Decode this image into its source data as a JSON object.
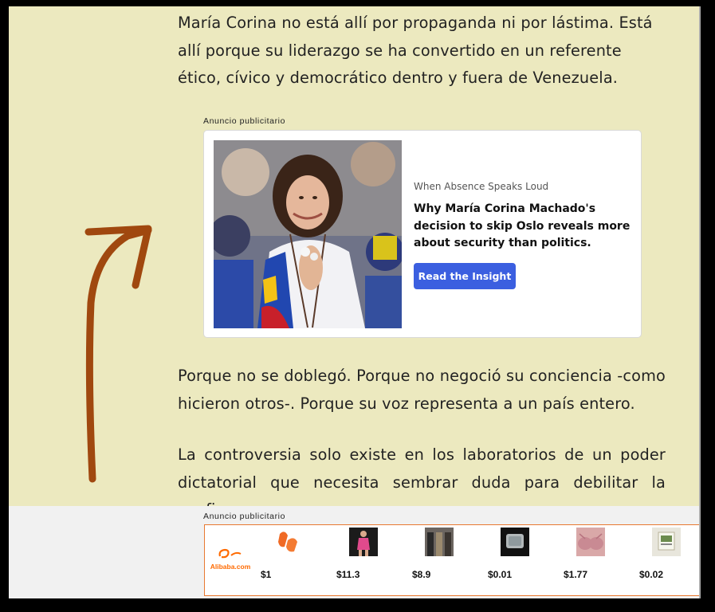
{
  "article": {
    "paragraphs": [
      "María Corina no está allí por propaganda ni por lástima. Está allí porque su liderazgo se ha convertido en un referente ético, cívico y democrático dentro y fuera de Venezuela.",
      "Porque no se doblegó. Porque no negoció su conciencia -como hicieron otros-. Porque su voz representa a un país entero.",
      "La controversia solo existe en los laboratorios de un poder dictatorial que necesita sembrar duda para debilitar la confianza."
    ]
  },
  "ad1": {
    "label": "Anuncio publicitario",
    "kicker": "When Absence Speaks Loud",
    "title": "Why María Corina Machado's decision to skip Oslo reveals more about security than politics.",
    "cta": "Read the Insight"
  },
  "ad2": {
    "label": "Anuncio publicitario",
    "logo_text": "Alibaba.com",
    "products": [
      {
        "price": "$1",
        "icon": "orange-earplugs-icon"
      },
      {
        "price": "$11.3",
        "icon": "pink-outfit-model-icon"
      },
      {
        "price": "$8.9",
        "icon": "trousers-models-icon"
      },
      {
        "price": "$0.01",
        "icon": "clear-case-icon"
      },
      {
        "price": "$1.77",
        "icon": "pink-bra-icon"
      },
      {
        "price": "$0.02",
        "icon": "label-sticker-icon"
      }
    ]
  },
  "colors": {
    "page_background": "#ece9bf",
    "cta_button": "#3b5fe0",
    "alibaba_orange": "#ff6a00",
    "arrow_annotation": "#a0480f"
  }
}
